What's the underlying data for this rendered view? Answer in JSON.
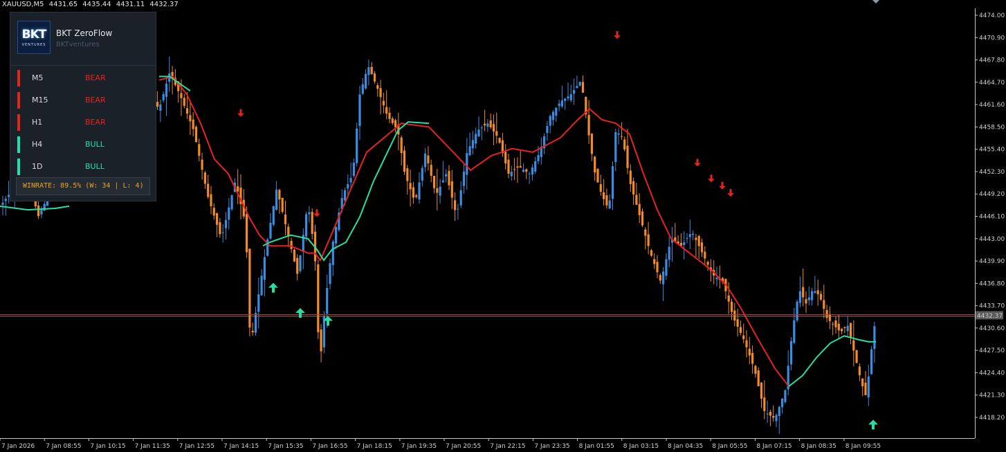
{
  "header": {
    "symbol": "XAUUSD,M5",
    "open": "4431.65",
    "high": "4435.44",
    "low": "4431.11",
    "close": "4432.37"
  },
  "panel": {
    "title": "BKT ZeroFlow",
    "subtitle": "BKTventures",
    "logo_text": "BKT",
    "logo_sub": "VENTURES",
    "timeframes": [
      {
        "label": "M5",
        "state": "BEAR",
        "color": "#e8231e"
      },
      {
        "label": "M15",
        "state": "BEAR",
        "color": "#e8231e"
      },
      {
        "label": "H1",
        "state": "BEAR",
        "color": "#e8231e"
      },
      {
        "label": "H4",
        "state": "BULL",
        "color": "#25e0a6"
      },
      {
        "label": "1D",
        "state": "BULL",
        "color": "#25e0a6"
      }
    ],
    "winrate": "WINRATE: 89.5%  (W: 34 | L: 4)"
  },
  "colors": {
    "bull_candle": "#3a8de0",
    "bear_candle": "#f28c28",
    "ma_bear": "#e8231e",
    "ma_bull": "#25e0a6",
    "arrow_up": "#25e0a6",
    "arrow_down": "#e8231e",
    "price_line": "#c0392b",
    "axis": "#cfcfcf"
  },
  "chart_data": {
    "type": "candlestick",
    "y_ticks": [
      4474.0,
      4470.9,
      4467.8,
      4464.7,
      4461.6,
      4458.5,
      4455.4,
      4452.3,
      4449.2,
      4446.1,
      4443.0,
      4439.9,
      4436.8,
      4433.7,
      4430.6,
      4427.5,
      4424.4,
      4421.3,
      4418.2
    ],
    "ylim": [
      4415.2,
      4475.1
    ],
    "current_price": 4432.37,
    "current_price_label": "4432.37",
    "x_ticks": [
      "7 Jan 2026",
      "7 Jan 08:55",
      "7 Jan 10:15",
      "7 Jan 11:35",
      "7 Jan 12:55",
      "7 Jan 14:15",
      "7 Jan 15:35",
      "7 Jan 16:55",
      "7 Jan 18:15",
      "7 Jan 19:35",
      "7 Jan 20:55",
      "7 Jan 22:15",
      "7 Jan 23:35",
      "8 Jan 01:55",
      "8 Jan 03:15",
      "8 Jan 04:35",
      "8 Jan 05:55",
      "8 Jan 07:15",
      "8 Jan 08:35",
      "8 Jan 09:55"
    ],
    "close_path": [
      [
        0,
        4447.5
      ],
      [
        20,
        4450.0
      ],
      [
        40,
        4452.0
      ],
      [
        55,
        4446.0
      ],
      [
        70,
        4449.0
      ],
      [
        90,
        4455.0
      ],
      [
        120,
        4458.5
      ],
      [
        150,
        4460.5
      ],
      [
        180,
        4462.0
      ],
      [
        210,
        4463.5
      ],
      [
        230,
        4461.0
      ],
      [
        245,
        4466.0
      ],
      [
        260,
        4463.0
      ],
      [
        280,
        4458.0
      ],
      [
        300,
        4449.0
      ],
      [
        320,
        4443.0
      ],
      [
        340,
        4451.0
      ],
      [
        355,
        4445.0
      ],
      [
        362,
        4428.0
      ],
      [
        370,
        4433.0
      ],
      [
        385,
        4442.0
      ],
      [
        400,
        4450.0
      ],
      [
        415,
        4444.0
      ],
      [
        430,
        4438.0
      ],
      [
        445,
        4448.0
      ],
      [
        455,
        4441.0
      ],
      [
        462,
        4425.0
      ],
      [
        470,
        4434.0
      ],
      [
        480,
        4442.0
      ],
      [
        495,
        4449.0
      ],
      [
        510,
        4452.0
      ],
      [
        520,
        4463.0
      ],
      [
        532,
        4467.0
      ],
      [
        545,
        4464.0
      ],
      [
        560,
        4460.0
      ],
      [
        575,
        4458.0
      ],
      [
        585,
        4452.0
      ],
      [
        600,
        4448.0
      ],
      [
        615,
        4455.0
      ],
      [
        630,
        4449.0
      ],
      [
        645,
        4452.0
      ],
      [
        660,
        4446.0
      ],
      [
        675,
        4455.0
      ],
      [
        690,
        4458.0
      ],
      [
        705,
        4459.0
      ],
      [
        720,
        4457.0
      ],
      [
        735,
        4452.0
      ],
      [
        750,
        4453.0
      ],
      [
        765,
        4452.0
      ],
      [
        780,
        4455.0
      ],
      [
        795,
        4460.0
      ],
      [
        810,
        4462.0
      ],
      [
        825,
        4463.0
      ],
      [
        840,
        4465.0
      ],
      [
        850,
        4458.0
      ],
      [
        860,
        4452.0
      ],
      [
        870,
        4449.0
      ],
      [
        880,
        4447.0
      ],
      [
        890,
        4458.0
      ],
      [
        900,
        4457.0
      ],
      [
        910,
        4451.0
      ],
      [
        925,
        4446.0
      ],
      [
        940,
        4441.0
      ],
      [
        955,
        4437.0
      ],
      [
        970,
        4443.0
      ],
      [
        985,
        4442.0
      ],
      [
        1000,
        4444.0
      ],
      [
        1015,
        4441.0
      ],
      [
        1030,
        4438.0
      ],
      [
        1045,
        4437.0
      ],
      [
        1060,
        4432.0
      ],
      [
        1075,
        4429.0
      ],
      [
        1090,
        4425.0
      ],
      [
        1105,
        4419.0
      ],
      [
        1120,
        4418.0
      ],
      [
        1135,
        4422.0
      ],
      [
        1145,
        4430.0
      ],
      [
        1155,
        4436.0
      ],
      [
        1165,
        4434.0
      ],
      [
        1175,
        4436.0
      ],
      [
        1185,
        4435.0
      ],
      [
        1195,
        4432.0
      ],
      [
        1205,
        4431.0
      ],
      [
        1215,
        4430.0
      ],
      [
        1225,
        4431.0
      ],
      [
        1235,
        4427.0
      ],
      [
        1245,
        4423.0
      ],
      [
        1252,
        4421.0
      ],
      [
        1260,
        4428.0
      ],
      [
        1266,
        4432.4
      ]
    ],
    "ma_red": [
      [
        230,
        4465.0
      ],
      [
        250,
        4465.5
      ],
      [
        270,
        4463.0
      ],
      [
        290,
        4459.0
      ],
      [
        310,
        4454.0
      ],
      [
        330,
        4452.0
      ],
      [
        345,
        4449.0
      ],
      [
        360,
        4446.0
      ],
      [
        375,
        4443.5
      ],
      [
        390,
        4442.0
      ],
      [
        420,
        4442.0
      ],
      [
        445,
        4441.0
      ],
      [
        455,
        4441.0
      ],
      [
        463,
        4440.0
      ],
      [
        530,
        4455.0
      ],
      [
        580,
        4459.0
      ],
      [
        620,
        4458.5
      ],
      [
        650,
        4455.5
      ],
      [
        680,
        4452.5
      ],
      [
        710,
        4454.5
      ],
      [
        740,
        4455.5
      ],
      [
        770,
        4455.0
      ],
      [
        810,
        4457.0
      ],
      [
        835,
        4459.5
      ],
      [
        852,
        4461.0
      ],
      [
        870,
        4459.5
      ],
      [
        890,
        4459.0
      ],
      [
        910,
        4457.5
      ],
      [
        930,
        4452.0
      ],
      [
        950,
        4447.0
      ],
      [
        970,
        4443.0
      ],
      [
        990,
        4441.5
      ],
      [
        1010,
        4440.0
      ],
      [
        1030,
        4438.5
      ],
      [
        1050,
        4436.5
      ],
      [
        1070,
        4433.5
      ],
      [
        1090,
        4430.0
      ],
      [
        1105,
        4427.5
      ],
      [
        1120,
        4425.0
      ],
      [
        1140,
        4422.5
      ]
    ],
    "ma_green": [
      [
        0,
        4447.5
      ],
      [
        40,
        4447.0
      ],
      [
        80,
        4447.2
      ],
      [
        100,
        4447.5
      ],
      [
        230,
        4465.5
      ],
      [
        245,
        4465.5
      ],
      [
        260,
        4464.5
      ],
      [
        275,
        4463.5
      ],
      [
        380,
        4442.0
      ],
      [
        390,
        4442.5
      ],
      [
        405,
        4443.0
      ],
      [
        420,
        4443.5
      ],
      [
        445,
        4443.0
      ],
      [
        458,
        4441.5
      ],
      [
        468,
        4440.0
      ],
      [
        480,
        4441.5
      ],
      [
        500,
        4442.5
      ],
      [
        520,
        4446.0
      ],
      [
        540,
        4451.0
      ],
      [
        560,
        4455.0
      ],
      [
        575,
        4458.0
      ],
      [
        590,
        4459.2
      ],
      [
        620,
        4459.0
      ],
      [
        1140,
        4422.5
      ],
      [
        1160,
        4424.0
      ],
      [
        1180,
        4426.5
      ],
      [
        1200,
        4428.5
      ],
      [
        1220,
        4429.5
      ],
      [
        1240,
        4429.0
      ],
      [
        1255,
        4428.7
      ],
      [
        1266,
        4428.7
      ]
    ],
    "arrows_down": [
      [
        892,
        4471.2
      ],
      [
        348,
        4460.4
      ],
      [
        1008,
        4453.5
      ],
      [
        1028,
        4451.3
      ],
      [
        1044,
        4450.3
      ],
      [
        1056,
        4449.3
      ],
      [
        458,
        4446.5
      ]
    ],
    "arrows_up": [
      [
        395,
        4436.2
      ],
      [
        434,
        4432.7
      ],
      [
        474,
        4431.6
      ],
      [
        1262,
        4417.2
      ]
    ]
  }
}
